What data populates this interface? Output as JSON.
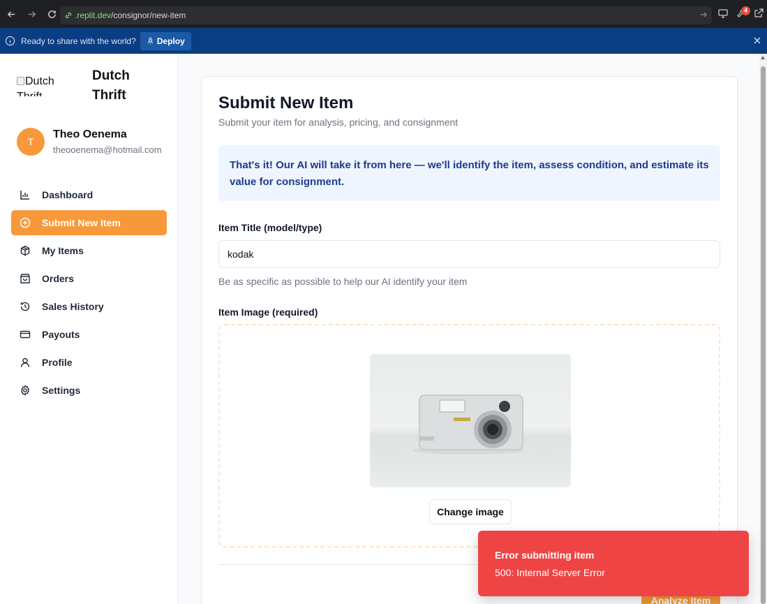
{
  "browser": {
    "url_host": ".replit.dev",
    "url_path": "/consignor/new-item",
    "notification_count": "4"
  },
  "banner": {
    "message": "Ready to share with the world?",
    "deploy_label": "Deploy"
  },
  "sidebar": {
    "logo_alt": "Dutch Thrift",
    "brand_line1": "Dutch",
    "brand_line2": "Thrift",
    "user": {
      "initial": "T",
      "name": "Theo Oenema",
      "email": "theooenema@hotmail.com"
    },
    "items": [
      {
        "label": "Dashboard",
        "icon": "bar-chart-icon",
        "active": false
      },
      {
        "label": "Submit New Item",
        "icon": "plus-circle-icon",
        "active": true
      },
      {
        "label": "My Items",
        "icon": "package-icon",
        "active": false
      },
      {
        "label": "Orders",
        "icon": "shopping-bag-icon",
        "active": false
      },
      {
        "label": "Sales History",
        "icon": "history-icon",
        "active": false
      },
      {
        "label": "Payouts",
        "icon": "credit-card-icon",
        "active": false
      },
      {
        "label": "Profile",
        "icon": "user-icon",
        "active": false
      },
      {
        "label": "Settings",
        "icon": "gear-icon",
        "active": false
      }
    ]
  },
  "main": {
    "title": "Submit New Item",
    "subtitle": "Submit your item for analysis, pricing, and consignment",
    "ai_message": "That's it! Our AI will take it from here — we'll identify the item, assess condition, and estimate its value for consignment.",
    "item_title_label": "Item Title (model/type)",
    "item_title_value": "kodak",
    "item_title_help": "Be as specific as possible to help our AI identify your item",
    "item_image_label": "Item Image (required)",
    "change_image_label": "Change image",
    "analyze_label": "Analyze Item"
  },
  "toast": {
    "title": "Error submitting item",
    "message": "500: Internal Server Error"
  },
  "colors": {
    "accent": "#f7993a",
    "error": "#ef4444",
    "banner": "#0b3d82",
    "info_box": "#eef5ff",
    "info_text": "#1e3a8a"
  }
}
